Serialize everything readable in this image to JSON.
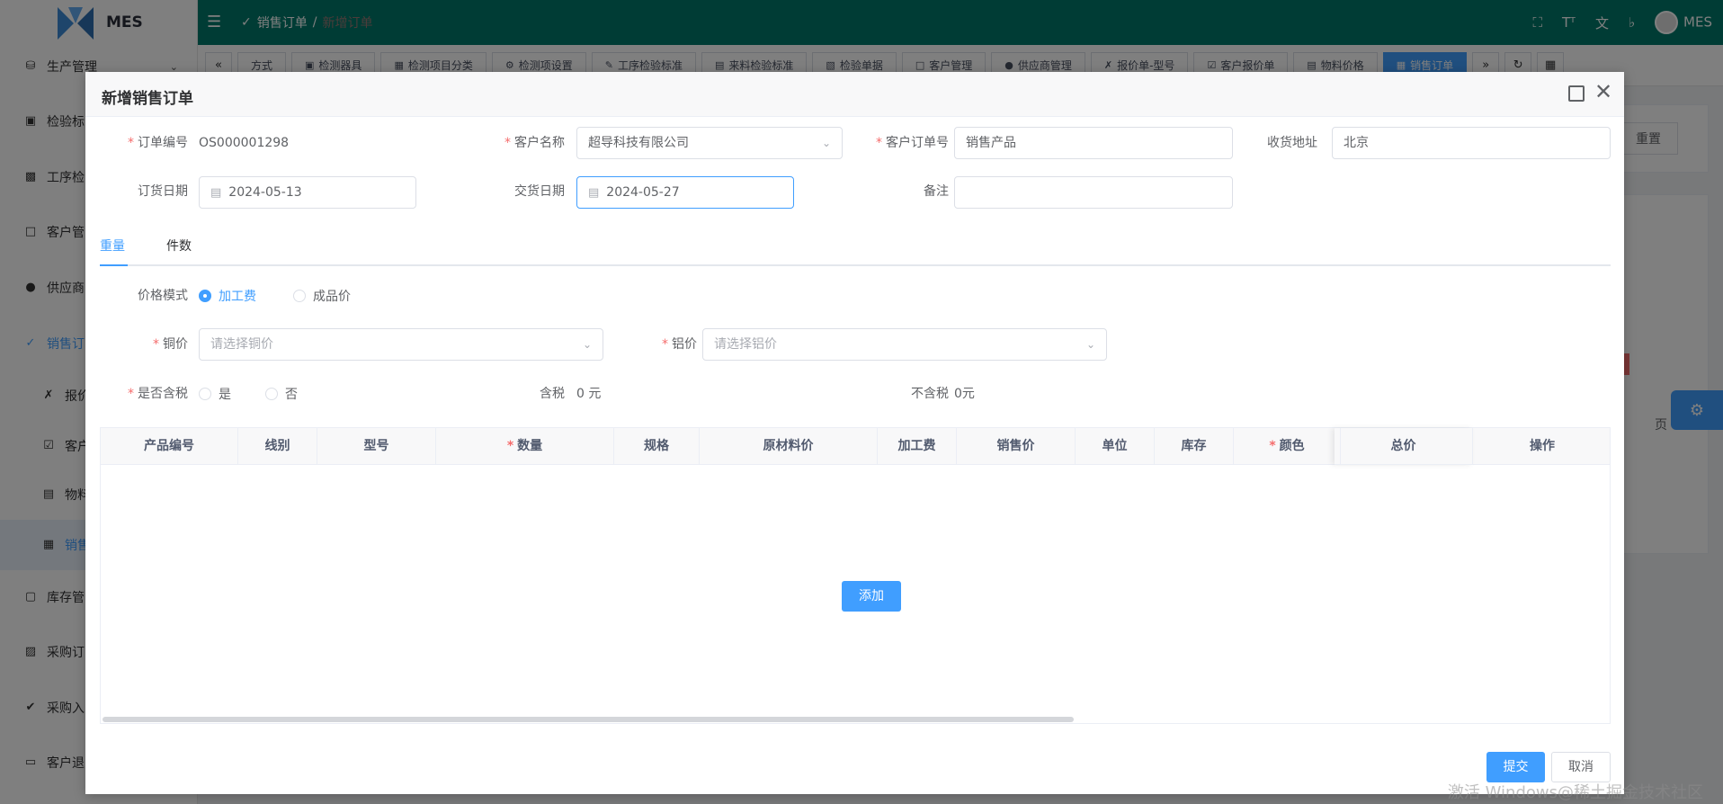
{
  "brand": {
    "name": "MES"
  },
  "sidebar": {
    "items": [
      {
        "label": "生产管理",
        "icon": "database-icon"
      },
      {
        "label": "检验标",
        "icon": "monitor-icon"
      },
      {
        "label": "工序检",
        "icon": "book-icon"
      },
      {
        "label": "客户管",
        "icon": "contact-card-icon"
      },
      {
        "label": "供应商",
        "icon": "user-icon"
      },
      {
        "label": "销售订",
        "icon": "sales-icon"
      },
      {
        "label": "报价",
        "icon": "tool-icon"
      },
      {
        "label": "客户",
        "icon": "clipboard-check-icon"
      },
      {
        "label": "物料",
        "icon": "price-icon"
      },
      {
        "label": "销售",
        "icon": "boxes-icon"
      },
      {
        "label": "库存管",
        "icon": "box-icon"
      },
      {
        "label": "采购订",
        "icon": "briefcase-icon"
      },
      {
        "label": "采购入",
        "icon": "double-check-icon"
      },
      {
        "label": "客户退",
        "icon": "inbox-icon"
      }
    ]
  },
  "topbar": {
    "breadcrumb": [
      "销售订单",
      "/",
      "新增订单"
    ]
  },
  "tags": [
    "方式",
    "检测器具",
    "检测项目分类",
    "检测项设置",
    "工序检验标准",
    "来料检验标准",
    "检验单据",
    "客户管理",
    "供应商管理",
    "报价单-型号",
    "客户报价单",
    "物料价格",
    "销售订单"
  ],
  "background": {
    "reset_label": "重置",
    "page_hint": "页"
  },
  "dialog": {
    "title": "新增销售订单",
    "fields": {
      "order_no": {
        "label": "订单编号",
        "value": "OS000001298"
      },
      "customer_name": {
        "label": "客户名称",
        "value": "超导科技有限公司"
      },
      "customer_order_no": {
        "label": "客户订单号",
        "value": "销售产品"
      },
      "address": {
        "label": "收货地址",
        "value": "北京"
      },
      "order_date": {
        "label": "订货日期",
        "value": "2024-05-13"
      },
      "delivery_date": {
        "label": "交货日期",
        "value": "2024-05-27"
      },
      "remark": {
        "label": "备注",
        "value": ""
      }
    },
    "tabs": [
      "重量",
      "件数"
    ],
    "price_mode": {
      "label": "价格模式",
      "options": [
        "加工费",
        "成品价"
      ],
      "selected": "加工费"
    },
    "copper": {
      "label": "铜价",
      "placeholder": "请选择铜价"
    },
    "aluminum": {
      "label": "铝价",
      "placeholder": "请选择铝价"
    },
    "tax": {
      "label": "是否含税",
      "options": [
        "是",
        "否"
      ],
      "with_tax_label": "含税",
      "with_tax_value": "0 元",
      "without_tax_label": "不含税",
      "without_tax_value": "0元"
    },
    "table": {
      "columns": [
        "产品编号",
        "线别",
        "型号",
        "数量",
        "规格",
        "原材料价",
        "加工费",
        "销售价",
        "单位",
        "库存",
        "颜色",
        "总价",
        "操作"
      ],
      "add_label": "添加"
    },
    "submit_label": "提交",
    "cancel_label": "取消"
  },
  "watermark": "激活 Windows@稀土掘金技术社区"
}
